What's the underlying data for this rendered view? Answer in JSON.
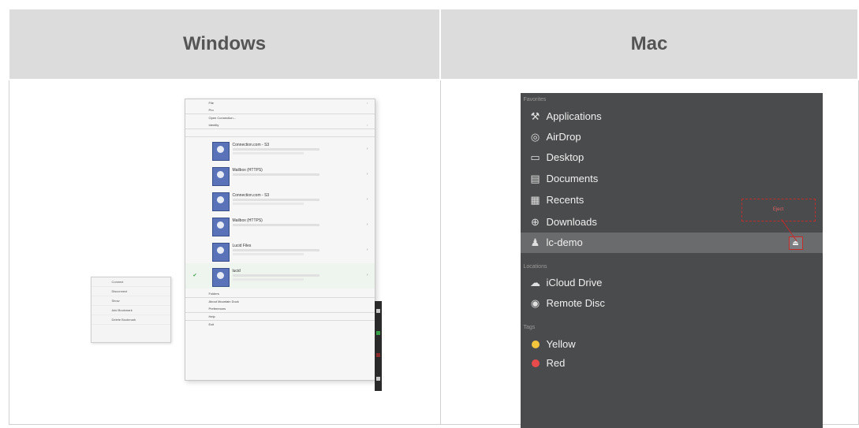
{
  "table": {
    "headers": [
      "Windows",
      "Mac"
    ]
  },
  "windows": {
    "menu_items_top": [
      "File",
      "Pro",
      "Open Connection...",
      "Identity",
      ""
    ],
    "accounts": [
      {
        "name": "Connection.com - S3",
        "active": false
      },
      {
        "name": "Mailbox (HTTPS)",
        "active": false
      },
      {
        "name": "Connection.com - S3",
        "active": false
      },
      {
        "name": "Mailbox (HTTPS)",
        "active": false
      },
      {
        "name": "Lucid Files",
        "active": false
      },
      {
        "name": "lucid",
        "active": true
      }
    ],
    "menu_items_bottom": [
      "Folders",
      "About Mountain Duck",
      "Preferences",
      "Help",
      "Exit"
    ],
    "tray_items": [
      "Connect",
      "Disconnect",
      "Show",
      "Add Bookmark",
      "Delete Bookmark"
    ]
  },
  "mac": {
    "sections": {
      "favorites": "Favorites",
      "locations": "Locations",
      "tags": "Tags"
    },
    "favorites": [
      {
        "label": "Applications",
        "icon": "applications-icon"
      },
      {
        "label": "AirDrop",
        "icon": "airdrop-icon"
      },
      {
        "label": "Desktop",
        "icon": "desktop-icon"
      },
      {
        "label": "Documents",
        "icon": "documents-icon"
      },
      {
        "label": "Recents",
        "icon": "recents-icon"
      },
      {
        "label": "Downloads",
        "icon": "downloads-icon"
      },
      {
        "label": "lc-demo",
        "icon": "drive-icon",
        "selected": true
      }
    ],
    "locations": [
      {
        "label": "iCloud Drive",
        "icon": "icloud-icon"
      },
      {
        "label": "Remote Disc",
        "icon": "disc-icon"
      }
    ],
    "tags": [
      {
        "label": "Yellow",
        "color": "#f2c53d"
      },
      {
        "label": "Red",
        "color": "#e84b4b"
      }
    ],
    "callout_text": "Eject",
    "eject_symbol": "⏏"
  }
}
